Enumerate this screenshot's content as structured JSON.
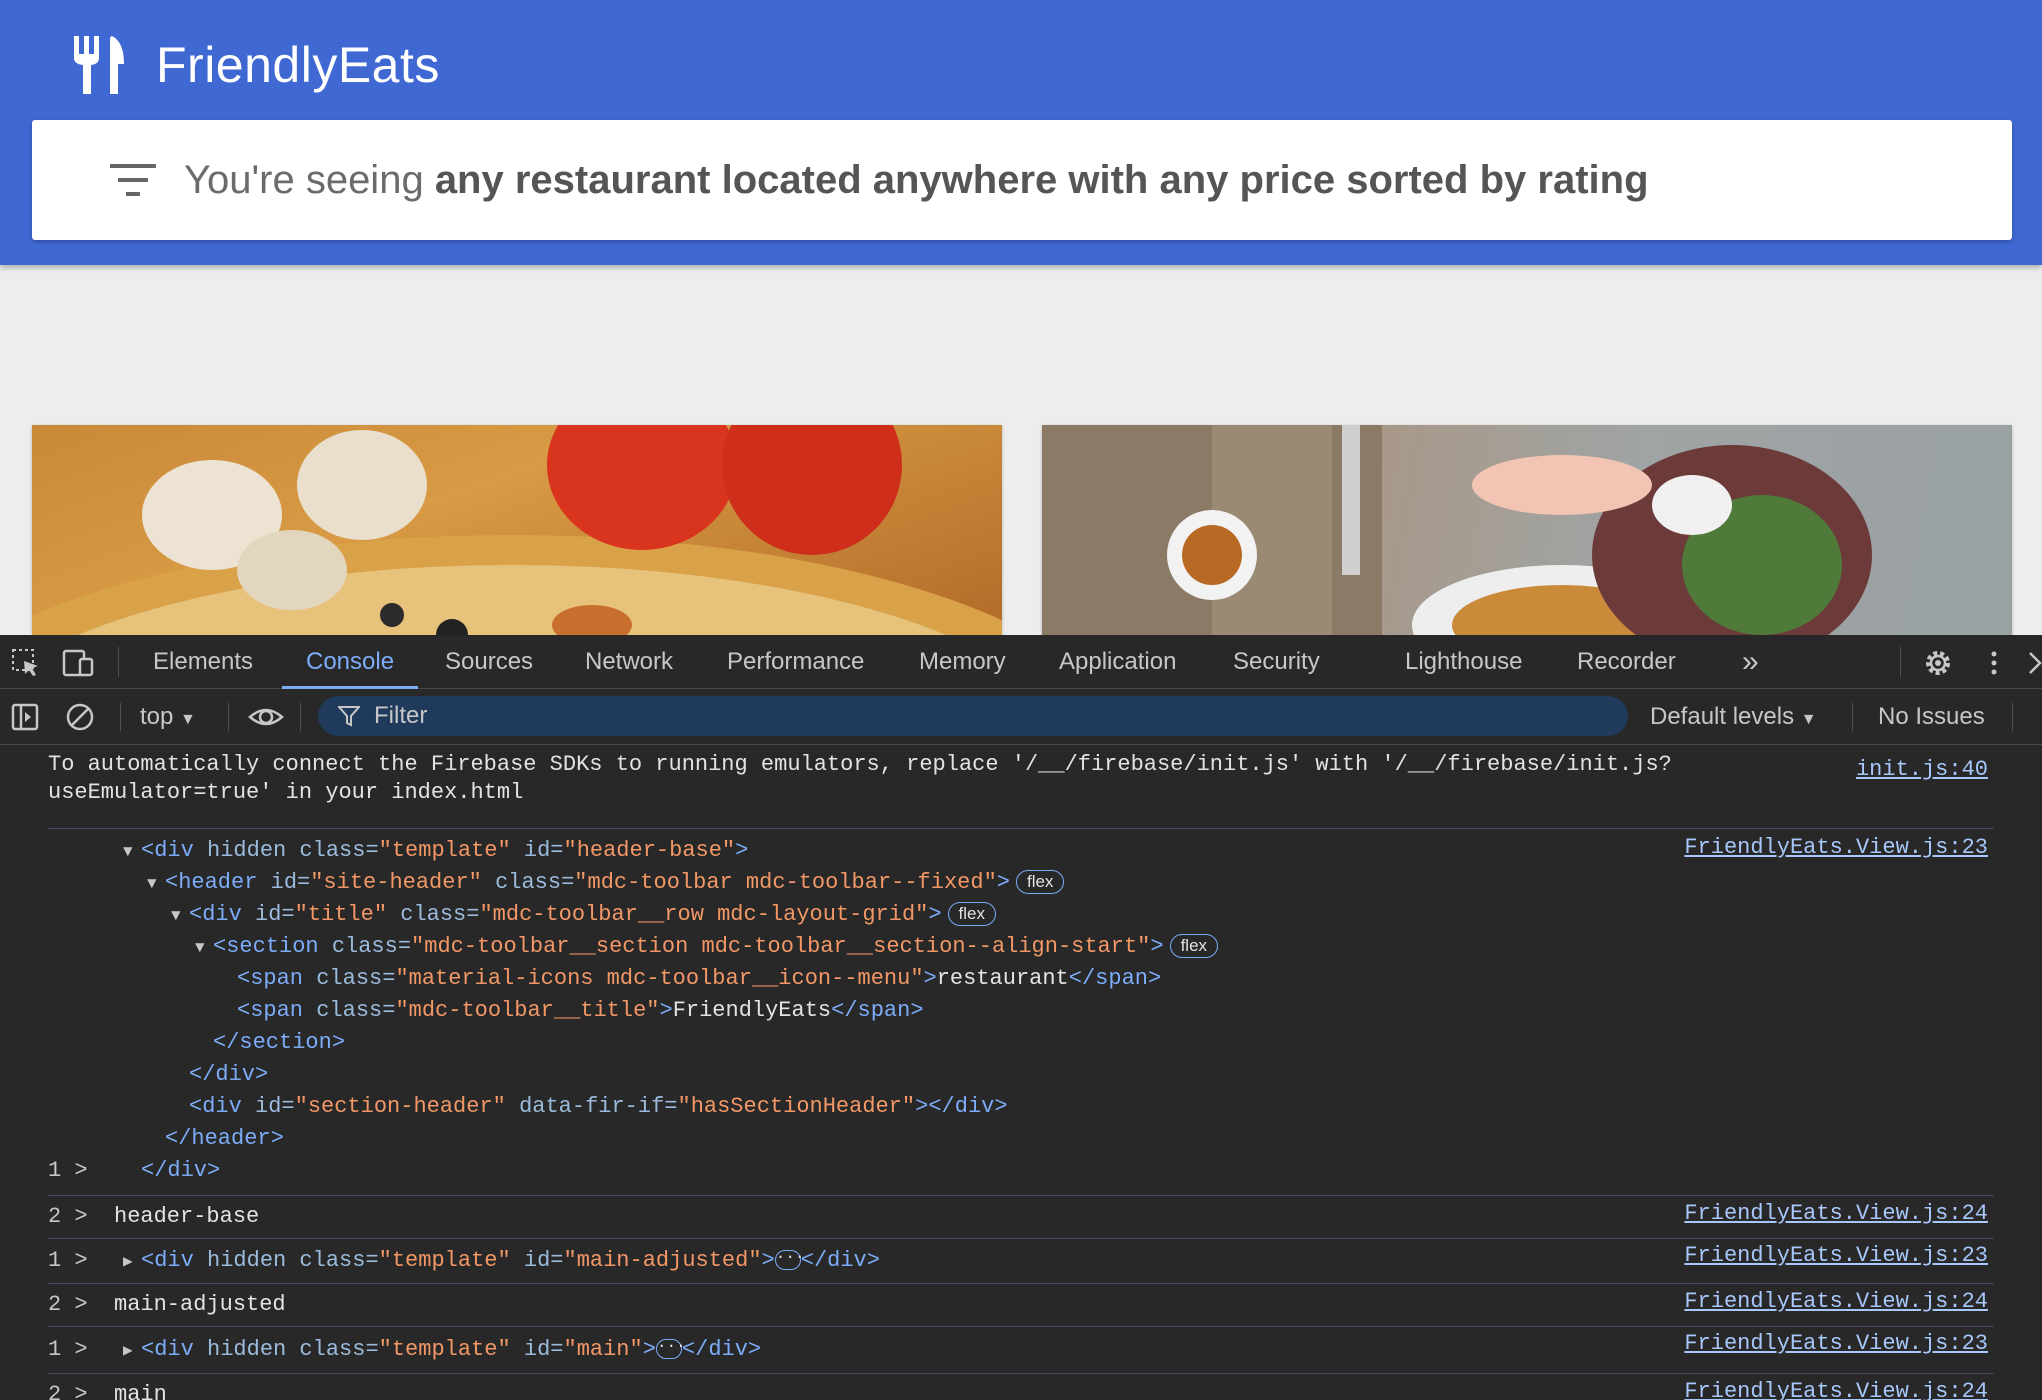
{
  "app": {
    "brand_title": "FriendlyEats",
    "filter_prefix": "You're seeing ",
    "filter_summary": "any restaurant located anywhere with any price sorted by rating"
  },
  "devtools": {
    "tabs": [
      "Elements",
      "Console",
      "Sources",
      "Network",
      "Performance",
      "Memory",
      "Application",
      "Security",
      "Lighthouse",
      "Recorder"
    ],
    "active_tab": "Console",
    "more_tabs": "»",
    "context": "top",
    "filter_placeholder": "Filter",
    "levels": "Default levels",
    "issues": "No Issues",
    "accent_color": "#7cacf8"
  },
  "console": {
    "emulator_message_line1": "To automatically connect the Firebase SDKs to running emulators, replace '/__/firebase/init.js' with '/__/firebase/init.js?",
    "emulator_message_line2": "useEmulator=true' in your index.html",
    "emulator_source": "init.js:40",
    "tree_source": "FriendlyEats.View.js:23",
    "tree_count": "1 >",
    "rows": [
      {
        "count": "2 >",
        "text": "header-base",
        "source": "FriendlyEats.View.js:24"
      },
      {
        "count": "1 >",
        "text": "main-adjusted",
        "source": "FriendlyEats.View.js:23"
      },
      {
        "count": "2 >",
        "text": "main-adjusted",
        "source": "FriendlyEats.View.js:24"
      },
      {
        "count": "1 >",
        "text": "main",
        "source": "FriendlyEats.View.js:23"
      },
      {
        "count": "2 >",
        "text": "main",
        "source": "FriendlyEats.View.js:24"
      }
    ],
    "badge_flex": "flex",
    "span_menu_text": "restaurant",
    "span_title_text": "FriendlyEats"
  }
}
